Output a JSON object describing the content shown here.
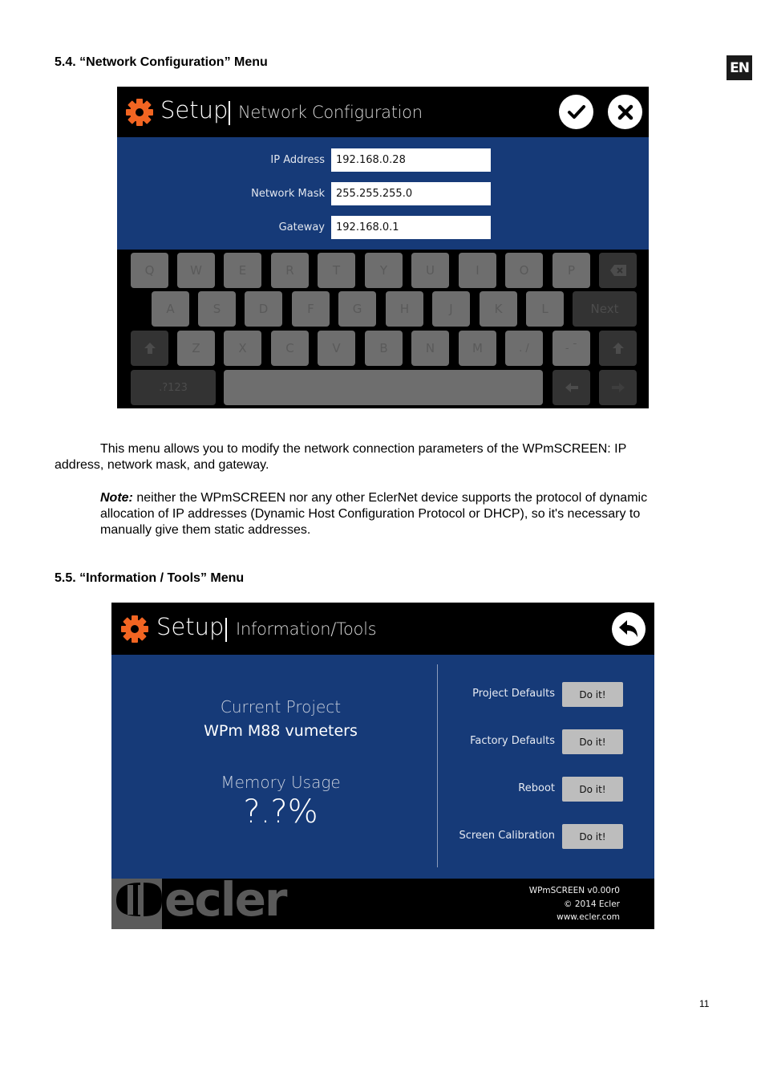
{
  "language_badge": "EN",
  "page_number": "11",
  "section_54": {
    "heading": "5.4. “Network Configuration” Menu",
    "screen": {
      "title": "Setup",
      "subtitle": "Network Configuration",
      "accent_color": "#f26522",
      "panel_color": "#163a78",
      "confirm_icon": "check-circle-icon",
      "cancel_icon": "close-circle-icon",
      "fields": [
        {
          "label": "IP Address",
          "value": "192.168.0.28"
        },
        {
          "label": "Network Mask",
          "value": "255.255.255.0"
        },
        {
          "label": "Gateway",
          "value": "192.168.0.1"
        }
      ],
      "keyboard": {
        "row1": [
          "Q",
          "W",
          "E",
          "R",
          "T",
          "Y",
          "U",
          "I",
          "O",
          "P"
        ],
        "row2": [
          "A",
          "S",
          "D",
          "F",
          "G",
          "H",
          "J",
          "K",
          "L"
        ],
        "row3": [
          "Z",
          "X",
          "C",
          "V",
          "B",
          "N",
          "M"
        ],
        "next_label": "Next",
        "symbols_label": ".?123",
        "dot_key": ". /",
        "dash_key": "- ¯"
      }
    },
    "paragraph": "This menu allows you to modify the network connection parameters of the WPmSCREEN: IP address, network mask, and gateway.",
    "paragraph_line1": "This menu allows you to modify the network connection parameters of the WPmSCREEN: IP",
    "paragraph_line2": "address, network mask, and gateway.",
    "note_label": "Note:",
    "note_line1": " neither the WPmSCREEN nor any other EclerNet device supports the protocol of dynamic",
    "note_line2": "allocation of IP addresses (Dynamic Host Configuration Protocol or DHCP), so it's necessary to",
    "note_line3": "manually give them static addresses."
  },
  "section_55": {
    "heading": "5.5. “Information / Tools” Menu",
    "screen": {
      "title": "Setup",
      "subtitle": "Information/Tools",
      "back_icon": "back-arrow-circle-icon",
      "current_project_label": "Current Project",
      "current_project_value": "WPm M88 vumeters",
      "memory_usage_label": "Memory Usage",
      "memory_usage_value": "?.?%",
      "tools": [
        {
          "label": "Project Defaults",
          "button": "Do it!"
        },
        {
          "label": "Factory Defaults",
          "button": "Do it!"
        },
        {
          "label": "Reboot",
          "button": "Do it!"
        },
        {
          "label": "Screen Calibration",
          "button": "Do it!"
        }
      ],
      "logo_text": "ecler",
      "footer": {
        "version": "WPmSCREEN v0.00r0",
        "copyright": "© 2014 Ecler",
        "website": "www.ecler.com"
      }
    }
  }
}
